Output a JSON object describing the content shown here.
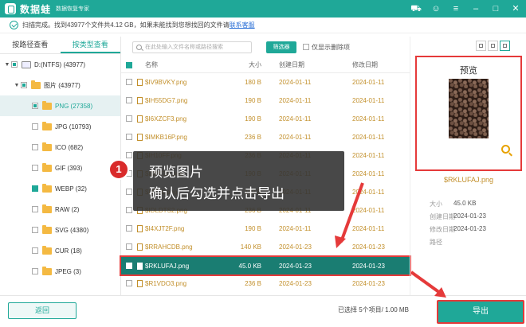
{
  "titlebar": {
    "app_name": "数据蛙",
    "app_sub": "数据恢复专家"
  },
  "status": {
    "text": "扫描完成。找到43977个文件共4.12 GB，如果未能找到您想找回的文件请",
    "link": "联系客服"
  },
  "tabs": [
    "按路径查看",
    "按类型查看"
  ],
  "tree": [
    {
      "label": "D:(NTFS) (43977)",
      "check": "half",
      "arrow": "▼"
    },
    {
      "label": "图片 (43977)",
      "check": "half",
      "arrow": "▼"
    },
    {
      "label": "PNG (27358)",
      "check": "half",
      "arrow": ""
    },
    {
      "label": "JPG (10793)",
      "check": "none",
      "arrow": ""
    },
    {
      "label": "ICO (682)",
      "check": "none",
      "arrow": ""
    },
    {
      "label": "GIF (393)",
      "check": "none",
      "arrow": ""
    },
    {
      "label": "WEBP (32)",
      "check": "full",
      "arrow": ""
    },
    {
      "label": "RAW (2)",
      "check": "none",
      "arrow": ""
    },
    {
      "label": "SVG (4380)",
      "check": "none",
      "arrow": ""
    },
    {
      "label": "CUR (18)",
      "check": "none",
      "arrow": ""
    },
    {
      "label": "JPEG (3)",
      "check": "none",
      "arrow": ""
    }
  ],
  "search": {
    "placeholder": "在此处输入文件名称或路径搜索"
  },
  "filter_button": "筛选器",
  "deleted_only": "仅显示删除项",
  "columns": {
    "name": "名称",
    "size": "大小",
    "created": "创建日期",
    "modified": "修改日期"
  },
  "files": [
    {
      "name": "$IV9BVKY.png",
      "size": "180 B",
      "created": "2024-01-11",
      "modified": "2024-01-11"
    },
    {
      "name": "$IH55DG7.png",
      "size": "190 B",
      "created": "2024-01-11",
      "modified": "2024-01-11"
    },
    {
      "name": "$I6XZCF3.png",
      "size": "190 B",
      "created": "2024-01-11",
      "modified": "2024-01-11"
    },
    {
      "name": "$IMKB16P.png",
      "size": "236 B",
      "created": "2024-01-11",
      "modified": "2024-01-11"
    },
    {
      "name": "$IH10FF.png",
      "size": "236 B",
      "created": "2024-01-11",
      "modified": "2024-01-11"
    },
    {
      "name": "$IBPF3D.png",
      "size": "190 B",
      "created": "2024-01-11",
      "modified": "2024-01-11"
    },
    {
      "name": "$I4T0L.png",
      "size": "190 B",
      "created": "2024-01-11",
      "modified": "2024-01-11"
    },
    {
      "name": "$IDLDTS2.png",
      "size": "236 B",
      "created": "2024-01-11",
      "modified": "2024-01-11"
    },
    {
      "name": "$I4XJT2F.png",
      "size": "190 B",
      "created": "2024-01-11",
      "modified": "2024-01-11"
    },
    {
      "name": "$RRAHCDB.png",
      "size": "140 KB",
      "created": "2024-01-23",
      "modified": "2024-01-23"
    },
    {
      "name": "$RKLUFAJ.png",
      "size": "45.0 KB",
      "created": "2024-01-23",
      "modified": "2024-01-23",
      "selected": true
    },
    {
      "name": "$R1VDO3.png",
      "size": "236 B",
      "created": "2024-01-23",
      "modified": "2024-01-23"
    }
  ],
  "overlay": {
    "badge": "1",
    "line1": "预览图片",
    "line2": "确认后勾选并点击导出"
  },
  "preview": {
    "title": "预览",
    "file_name": "$RKLUFAJ.png",
    "meta": [
      {
        "label": "大小",
        "value": "45.0 KB"
      },
      {
        "label": "创建日期",
        "value": "2024-01-23"
      },
      {
        "label": "修改日期",
        "value": "2024-01-23"
      },
      {
        "label": "路径",
        "value": ""
      }
    ]
  },
  "bottom": {
    "back": "返回",
    "selected_info": "已选择 5个项目/ 1.00 MB",
    "export": "导出"
  },
  "colors": {
    "accent": "#1fa898",
    "highlight": "#e53a3a",
    "file_text": "#c28f2a"
  }
}
